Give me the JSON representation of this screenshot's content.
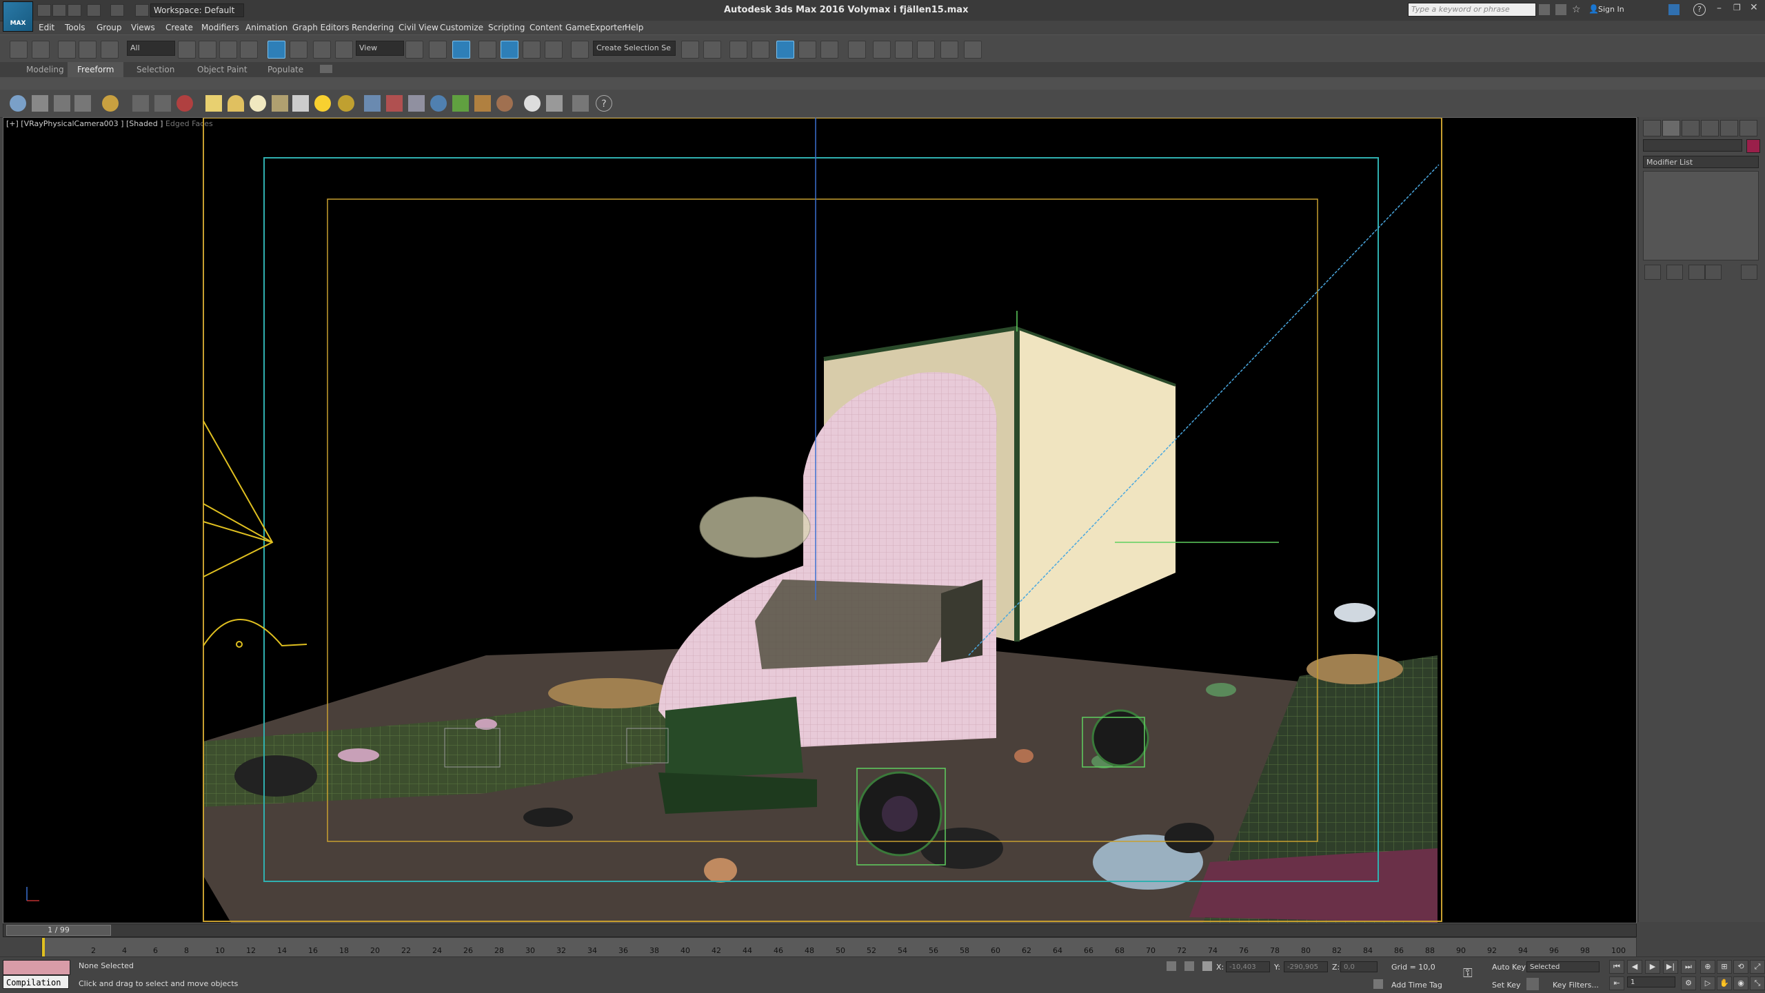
{
  "app": {
    "title": "Autodesk 3ds Max 2016    Volymax i fjällen15.max",
    "logo_text": "MAX",
    "workspace": "Workspace: Default",
    "search_placeholder": "Type a keyword or phrase",
    "sign_in": "Sign In"
  },
  "menu": [
    "Edit",
    "Tools",
    "Group",
    "Views",
    "Create",
    "Modifiers",
    "Animation",
    "Graph Editors",
    "Rendering",
    "Civil View",
    "Customize",
    "Scripting",
    "Content",
    "GameExporter",
    "Help"
  ],
  "toolbar": {
    "selection_filter": "All",
    "ref_coord": "View",
    "named_selection": "Create Selection Se"
  },
  "ribbon_tabs": [
    "Modeling",
    "Freeform",
    "Selection",
    "Object Paint",
    "Populate"
  ],
  "ribbon_active": "Freeform",
  "viewport": {
    "label_main": "[+] [VRayPhysicalCamera003 ] [Shaded ]",
    "label_dim": "Edged Faces"
  },
  "command_panel": {
    "modifier_list": "Modifier List",
    "color": "#9a1f4a"
  },
  "timeline": {
    "frame": "1 / 99",
    "ticks": [
      "2",
      "4",
      "6",
      "8",
      "10",
      "12",
      "14",
      "16",
      "18",
      "20",
      "22",
      "24",
      "26",
      "28",
      "30",
      "32",
      "34",
      "36",
      "38",
      "40",
      "42",
      "44",
      "46",
      "48",
      "50",
      "52",
      "54",
      "56",
      "58",
      "60",
      "62",
      "64",
      "66",
      "68",
      "70",
      "72",
      "74",
      "76",
      "78",
      "80",
      "82",
      "84",
      "86",
      "88",
      "90",
      "92",
      "94",
      "96",
      "98",
      "100"
    ]
  },
  "status": {
    "compilation": "Compilation",
    "selection": "None Selected",
    "prompt": "Click and drag to select and move objects",
    "x_label": "X:",
    "x_val": "-10,403",
    "y_label": "Y:",
    "y_val": "-290,905",
    "z_label": "Z:",
    "z_val": "0,0",
    "grid": "Grid = 10,0",
    "add_time_tag": "Add Time Tag",
    "auto_key": "Auto Key",
    "key_mode": "Selected",
    "set_key": "Set Key",
    "key_filters": "Key Filters...",
    "current_frame": "1"
  }
}
